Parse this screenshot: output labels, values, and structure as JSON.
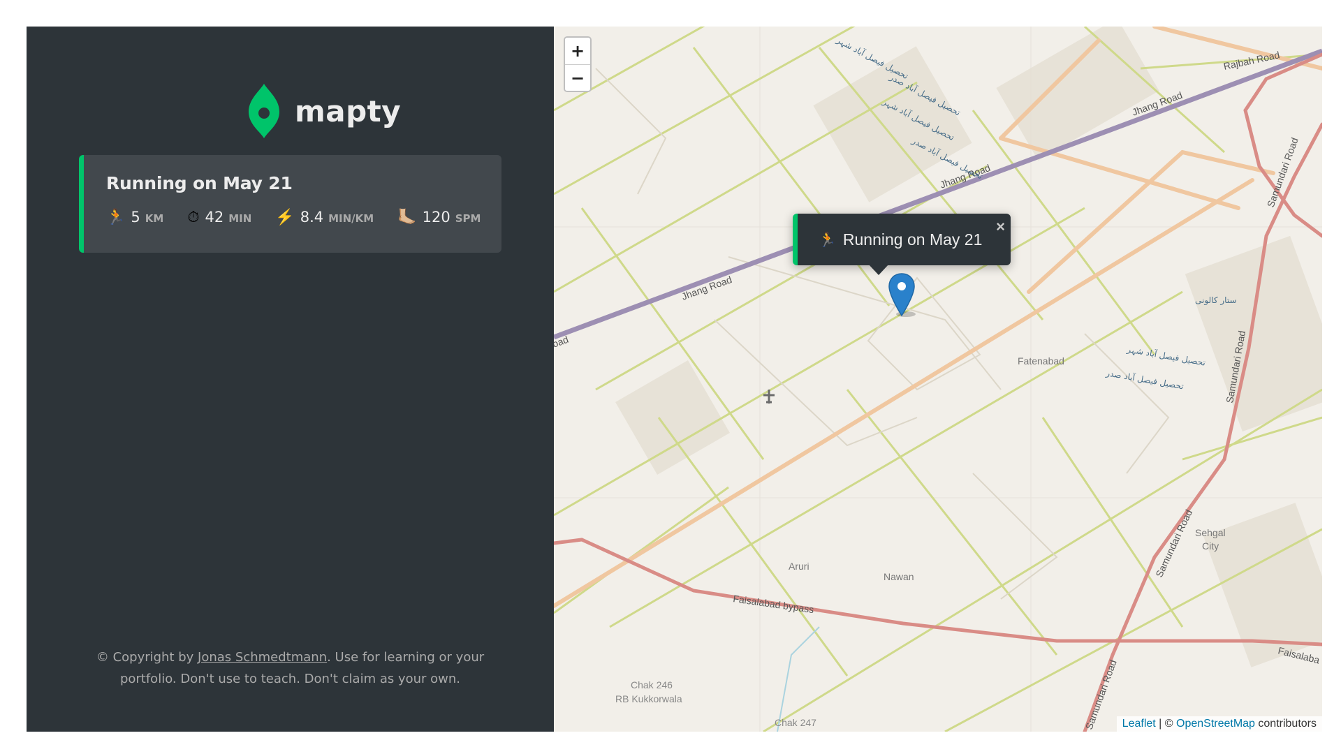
{
  "app": {
    "logo_text": "mapty",
    "brand_color": "#00c46a"
  },
  "workouts": [
    {
      "title": "Running on May 21",
      "distance": {
        "icon": "running-icon",
        "glyph": "🏃",
        "value": "5",
        "unit": "km"
      },
      "duration": {
        "icon": "stopwatch-icon",
        "glyph": "⏱",
        "value": "42",
        "unit": "min"
      },
      "pace": {
        "icon": "lightning-icon",
        "glyph": "⚡️",
        "value": "8.4",
        "unit": "min/km"
      },
      "cadence": {
        "icon": "foot-icon",
        "glyph": "🦶🏼",
        "value": "120",
        "unit": "spm"
      }
    }
  ],
  "copyright": {
    "prefix": "© Copyright by ",
    "author": "Jonas Schmedtmann",
    "suffix": ". Use for learning or your portfolio. Don't use to teach. Don't claim as your own."
  },
  "map": {
    "zoom_in": "+",
    "zoom_out": "−",
    "popup": {
      "glyph": "🏃",
      "text": "Running on May 21",
      "close": "×"
    },
    "attribution": {
      "leaflet": "Leaflet",
      "sep": " | © ",
      "osm": "OpenStreetMap",
      "suffix": " contributors"
    },
    "labels": {
      "jhang_road_1": "Jhang Road",
      "jhang_road_2": "Jhang Road",
      "jhang_road_3": "Jhang Road",
      "jhang_road_4": "oad",
      "rajbah_road": "Rajbah Road",
      "samundari_road_1": "Samundari Road",
      "samundari_road_2": "Samundari Road",
      "samundari_road_3": "Samundari Road",
      "samundari_road_4": "Samundari Road",
      "faisalabad_bypass": "Faisalabad bypass",
      "faisalaba": "Faisalaba",
      "fatenabad": "Fatenabad",
      "aruri": "Aruri",
      "nawan": "Nawan",
      "sehgal_city_1": "Sehgal",
      "sehgal_city_2": "City",
      "chak246_1": "Chak 246",
      "chak246_2": "RB Kukkorwala",
      "chak247": "Chak 247",
      "urdu_1": "تحصیل فیصل آباد شہر",
      "urdu_2": "تحصیل فیصل آباد صدر",
      "urdu_3": "تحصیل فیصل آباد شہر",
      "urdu_4": "تحصیل فیصل آباد صدر",
      "urdu_5": "تحصیل فیصل آباد شہر",
      "urdu_6": "تحصیل فیصل آباد صدر",
      "urdu_7": "ستار کالونی"
    },
    "colors": {
      "land": "#f2efe9",
      "major_road": "#9d8fb3",
      "trunk": "#d98c86",
      "secondary": "#f0c7a0",
      "minor": "#cfd98a"
    }
  }
}
